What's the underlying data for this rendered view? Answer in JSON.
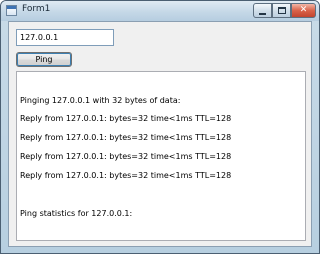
{
  "window": {
    "title": "Form1",
    "caption_buttons": {
      "minimize": "minimize-icon",
      "maximize": "maximize-icon",
      "close": "✕"
    }
  },
  "form": {
    "ip_input_value": "127.0.0.1",
    "ping_button_label": "Ping"
  },
  "output": {
    "lines": [
      "Pinging 127.0.0.1 with 32 bytes of data:",
      "Reply from 127.0.0.1: bytes=32 time<1ms TTL=128",
      "Reply from 127.0.0.1: bytes=32 time<1ms TTL=128",
      "Reply from 127.0.0.1: bytes=32 time<1ms TTL=128",
      "Reply from 127.0.0.1: bytes=32 time<1ms TTL=128",
      "",
      "Ping statistics for 127.0.0.1:"
    ]
  },
  "colors": {
    "client_background": "#f0f0f0",
    "close_button": "#c2452f",
    "button_focus_border": "#3c7fb1"
  }
}
